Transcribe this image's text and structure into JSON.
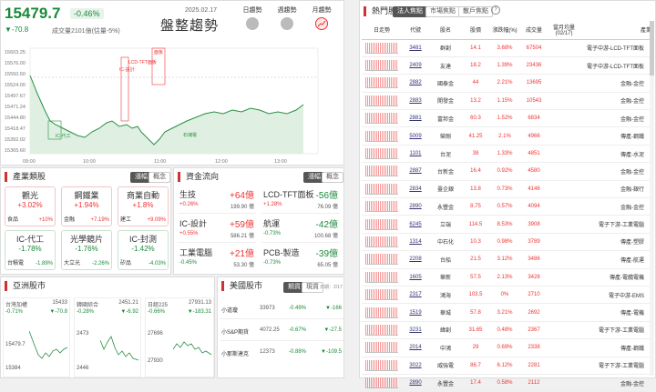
{
  "index": {
    "value": "15479.7",
    "change": "▼-70.8",
    "pct": "-0.46%",
    "volume": "成交量2101億(估量-5%)",
    "date": "2025.02.17",
    "title": "盤整趨勢",
    "trend_buttons": [
      {
        "label": "日趨勢",
        "active": false
      },
      {
        "label": "週趨勢",
        "active": false
      },
      {
        "label": "月趨勢",
        "active": true
      }
    ]
  },
  "intraday": {
    "y_ticks": [
      "15603.25",
      "15576.00",
      "15550.50",
      "15524.00",
      "15497.67",
      "15471.24",
      "15444.80",
      "15418.47",
      "15392.02",
      "15365.60"
    ],
    "x_ticks": [
      "09:00",
      "10:00",
      "11:00",
      "12:00",
      "13:00"
    ],
    "annotations": [
      "面板",
      "LCD-TFT面板",
      "IC-設計",
      "IC-代工",
      "石塊電"
    ]
  },
  "industry": {
    "title": "產業類股",
    "tabs": [
      "漲幅",
      "概念"
    ],
    "cards": [
      {
        "name": "觀光",
        "pct": "+3.02%",
        "c": "red",
        "sub": "漲幅",
        "sub_left": "食品",
        "sub_right": "+10%",
        "sc": "red"
      },
      {
        "name": "鋼鐵業",
        "pct": "+1.94%",
        "c": "red",
        "sub_left": "金融",
        "sub_right": "+7.19%",
        "sc": "red"
      },
      {
        "name": "商業自動",
        "pct": "+1.8%",
        "c": "red",
        "sub_left": "建工",
        "sub_right": "+9.09%",
        "sc": "red"
      },
      {
        "name": "IC-代工",
        "pct": "-1.78%",
        "c": "green",
        "sub_left": "台積電",
        "sub_right": "-1.89%",
        "sc": "green"
      },
      {
        "name": "光學鏡片",
        "pct": "-1.76%",
        "c": "green",
        "sub_left": "大立光",
        "sub_right": "-2.26%",
        "sc": "green"
      },
      {
        "name": "IC-封測",
        "pct": "-1.42%",
        "c": "green",
        "sub_left": "矽品",
        "sub_right": "-4.03%",
        "sc": "green"
      }
    ]
  },
  "fund": {
    "title": "資金流向",
    "tabs": [
      "漲幅",
      "概念"
    ],
    "cards": [
      {
        "name": "生技",
        "amt": "+64億",
        "pct": "+0.26%",
        "sub": "199.90 億",
        "c": "red"
      },
      {
        "name": "LCD-TFT面板",
        "amt": "-56億",
        "pct": "+1.28%",
        "sub": "76.09 億",
        "c": "green"
      },
      {
        "name": "IC-設計",
        "amt": "+59億",
        "pct": "+0.55%",
        "sub": "586.21 億",
        "c": "red"
      },
      {
        "name": "航運",
        "amt": "-42億",
        "pct": "-0.73%",
        "sub": "100.68 億",
        "c": "green"
      },
      {
        "name": "工業電腦",
        "amt": "+21億",
        "pct": "-0.45%",
        "sub": "53.30 億",
        "c": "red"
      },
      {
        "name": "PCB-製造",
        "amt": "-39億",
        "pct": "-0.73%",
        "sub": "65.05 億",
        "c": "green"
      }
    ]
  },
  "asia": {
    "title": "亞洲股市",
    "cards": [
      {
        "name": "台灣加權",
        "value": "15479.7",
        "pct": "-0.71%",
        "chg": "▼-70.8",
        "hi": "15433",
        "lo": "15384"
      },
      {
        "name": "韓國綜合",
        "value": "2451.21",
        "pct": "-0.28%",
        "chg": "▼-6.92",
        "hi": "2473",
        "lo": "2446"
      },
      {
        "name": "日經225",
        "value": "27931.13",
        "pct": "-0.66%",
        "chg": "▼-183.31",
        "hi": "27696",
        "lo": "27930"
      }
    ]
  },
  "us": {
    "title": "美國股市",
    "tabs": [
      "期貨",
      "現貨"
    ],
    "date": "日期：2/17",
    "rows": [
      {
        "name": "小道瓊",
        "value": "33973",
        "pct": "-0.49%",
        "chg": "▼-166"
      },
      {
        "name": "小S&P期貨",
        "value": "4072.25",
        "pct": "-0.67%",
        "chg": "▼-27.5"
      },
      {
        "name": "小那斯達克",
        "value": "12373",
        "pct": "-0.88%",
        "chg": "▼-109.5"
      }
    ]
  },
  "hot": {
    "title": "熱門股",
    "tabs": [
      "法人焦點",
      "市場焦點",
      "散戶焦點"
    ],
    "help": "?",
    "headers": [
      "日走勢",
      "代號",
      "股名",
      "股價",
      "漲跌幅(%)",
      "成交量",
      "當月均量(02/17)",
      "產業"
    ],
    "rows": [
      {
        "code": "3481",
        "name": "群創",
        "price": "14.1",
        "pct": "3.68%",
        "vol": "67504",
        "ind": "電子中游-LCD-TFT面板"
      },
      {
        "code": "2409",
        "name": "友達",
        "price": "18.2",
        "pct": "1.39%",
        "vol": "23436",
        "ind": "電子中游-LCD-TFT面板"
      },
      {
        "code": "2882",
        "name": "國泰金",
        "price": "44",
        "pct": "2.21%",
        "vol": "13695",
        "ind": "金融-金控"
      },
      {
        "code": "2883",
        "name": "開發金",
        "price": "13.2",
        "pct": "1.15%",
        "vol": "10543",
        "ind": "金融-金控"
      },
      {
        "code": "2881",
        "name": "富邦金",
        "price": "60.3",
        "pct": "1.52%",
        "vol": "6834",
        "ind": "金融-金控"
      },
      {
        "code": "5009",
        "name": "榮剛",
        "price": "41.25",
        "pct": "2.1%",
        "vol": "4966",
        "ind": "傳產-鋼鐵"
      },
      {
        "code": "1101",
        "name": "台泥",
        "price": "38",
        "pct": "1.33%",
        "vol": "4851",
        "ind": "傳產-水泥"
      },
      {
        "code": "2887",
        "name": "台新金",
        "price": "16.4",
        "pct": "0.92%",
        "vol": "4580",
        "ind": "金融-金控"
      },
      {
        "code": "2834",
        "name": "臺企銀",
        "price": "13.8",
        "pct": "0.73%",
        "vol": "4146",
        "ind": "金融-銀行"
      },
      {
        "code": "2890",
        "name": "永豐金",
        "price": "8.75",
        "pct": "0.57%",
        "vol": "4094",
        "ind": "金融-金控"
      },
      {
        "code": "6245",
        "name": "立端",
        "price": "114.5",
        "pct": "8.53%",
        "vol": "3908",
        "ind": "電子下游-工業電腦"
      },
      {
        "code": "1314",
        "name": "中石化",
        "price": "10.3",
        "pct": "0.98%",
        "vol": "3789",
        "ind": "傳產-塑膠"
      },
      {
        "code": "2208",
        "name": "台船",
        "price": "21.5",
        "pct": "3.12%",
        "vol": "3486",
        "ind": "傳產-航運"
      },
      {
        "code": "1605",
        "name": "華新",
        "price": "57.5",
        "pct": "2.13%",
        "vol": "3428",
        "ind": "傳產-電纜電機"
      },
      {
        "code": "2317",
        "name": "鴻海",
        "price": "103.5",
        "pct": "0%",
        "vol": "2710",
        "ind": "電子中游-EMS"
      },
      {
        "code": "1519",
        "name": "華城",
        "price": "57.8",
        "pct": "3.21%",
        "vol": "2692",
        "ind": "傳產-電機"
      },
      {
        "code": "3231",
        "name": "緯創",
        "price": "31.65",
        "pct": "0.48%",
        "vol": "2367",
        "ind": "電子下游-工業電腦"
      },
      {
        "code": "2014",
        "name": "中鴻",
        "price": "29",
        "pct": "0.69%",
        "vol": "2338",
        "ind": "傳產-鋼鐵"
      },
      {
        "code": "3022",
        "name": "威強電",
        "price": "86.7",
        "pct": "6.12%",
        "vol": "2281",
        "ind": "電子下游-工業電腦"
      },
      {
        "code": "2890",
        "name": "永豐金",
        "price": "17.4",
        "pct": "0.58%",
        "vol": "2112",
        "ind": "金融-金控"
      }
    ]
  }
}
